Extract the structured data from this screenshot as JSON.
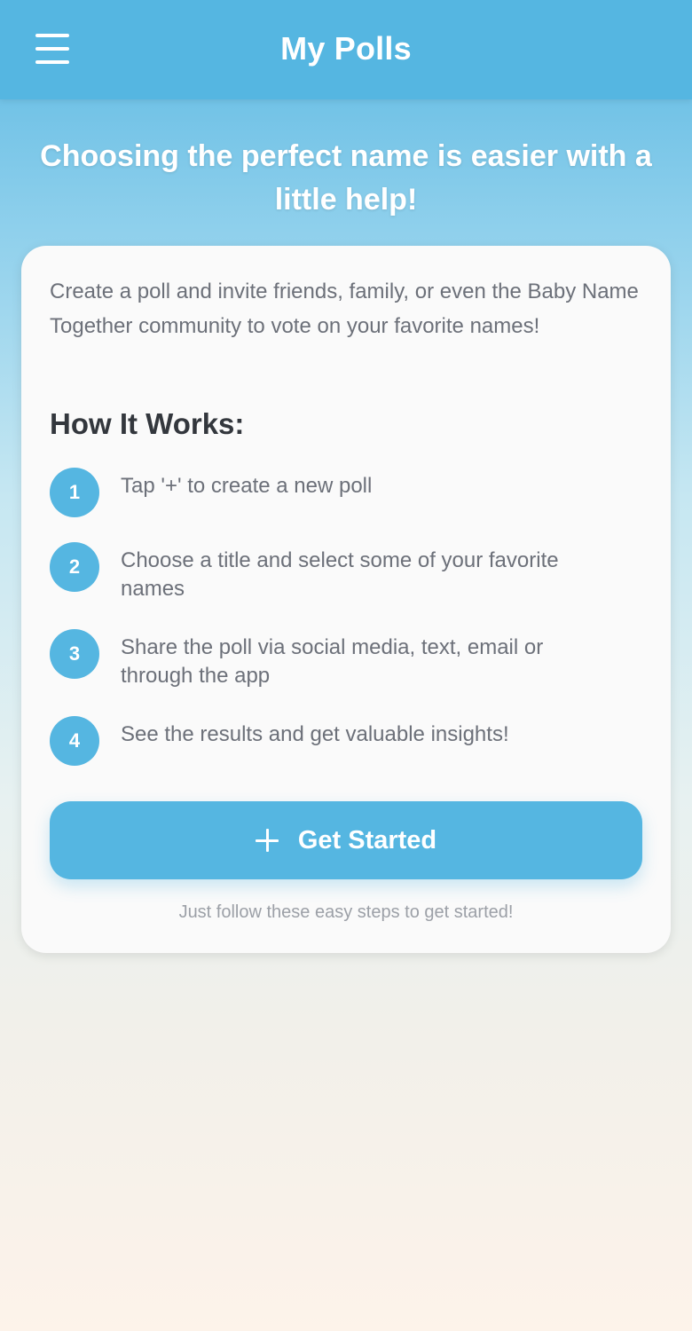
{
  "header": {
    "title": "My Polls",
    "menu_icon": "hamburger-menu-icon"
  },
  "hero": {
    "headline": "Choosing the perfect name is easier with a little help!"
  },
  "card": {
    "intro": "Create a poll and invite friends, family, or even the Baby Name Together community to vote on your favorite names!",
    "how_title": "How It Works:",
    "steps": [
      {
        "number": "1",
        "text": "Tap '+' to create a new poll"
      },
      {
        "number": "2",
        "text": "Choose a title and select some of your favorite names"
      },
      {
        "number": "3",
        "text": "Share the poll via social media, text, email or through the app"
      },
      {
        "number": "4",
        "text": "See the results and get valuable insights!"
      }
    ],
    "cta_label": "Get Started",
    "cta_icon": "plus-icon",
    "footnote": "Just follow these easy steps to get started!"
  },
  "colors": {
    "accent": "#55b6e1",
    "card_background": "#fafafa",
    "heading_text": "#33373d",
    "body_text": "#6c7079",
    "muted_text": "#9ca0a7"
  }
}
